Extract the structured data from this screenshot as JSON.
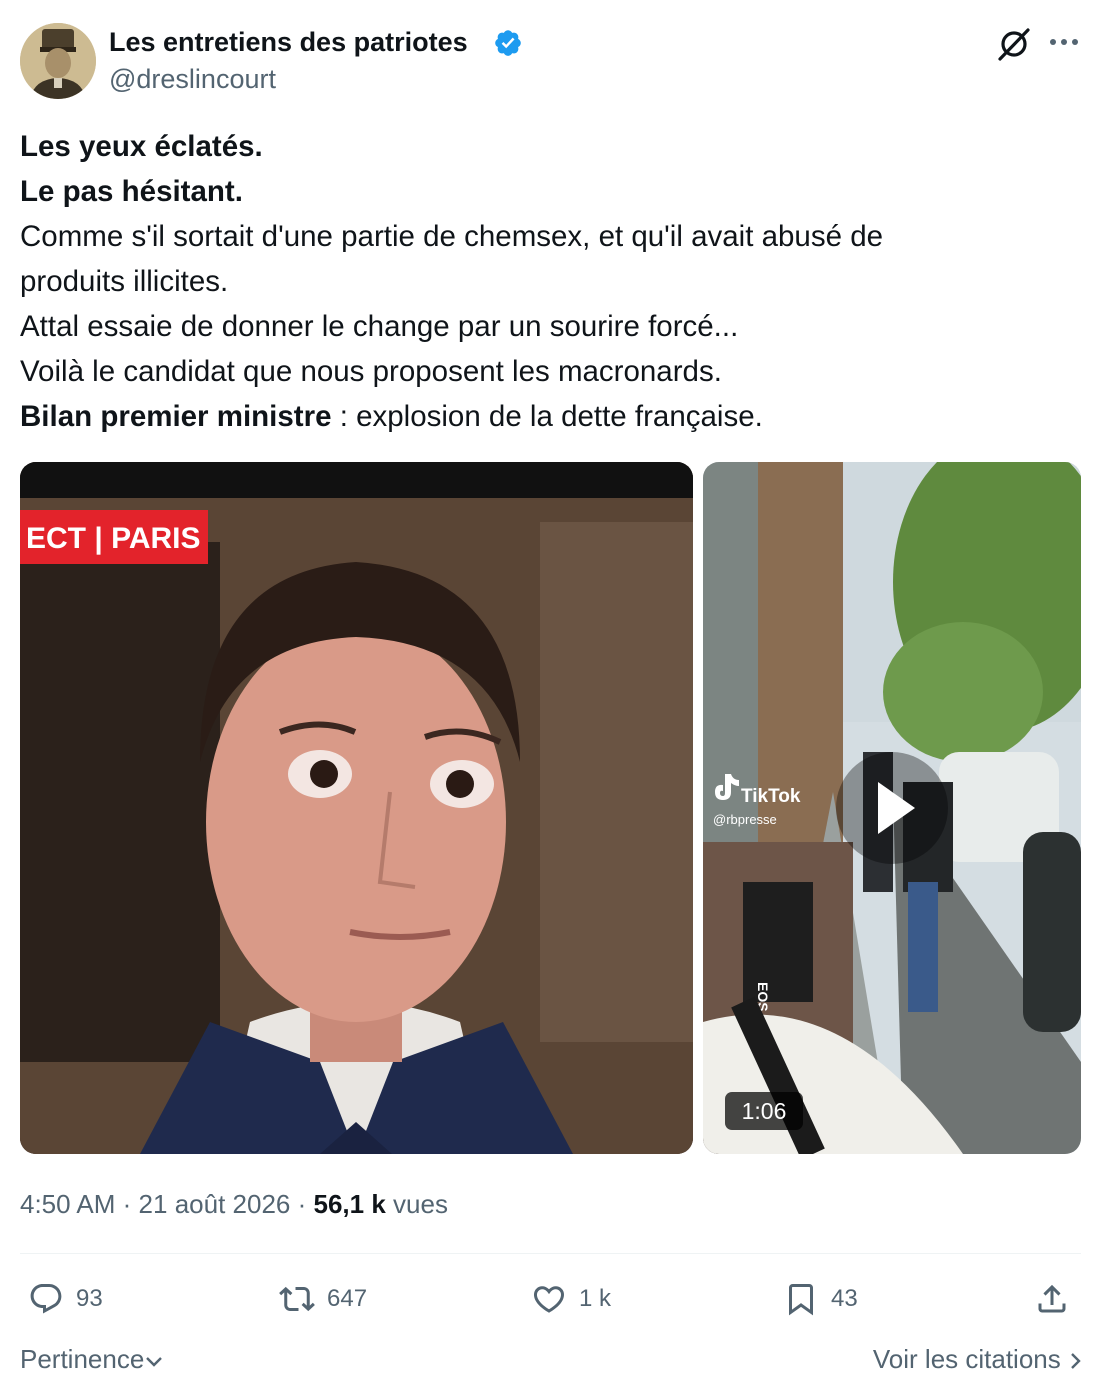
{
  "author": {
    "name": "Les entretiens des patriotes",
    "handle": "@dreslincourt"
  },
  "post": {
    "lines": [
      {
        "bold": "Les yeux éclatés.",
        "rest": ""
      },
      {
        "bold": "Le pas hésitant.",
        "rest": ""
      },
      {
        "bold": "",
        "rest": "Comme s'il sortait d'une partie de chemsex, et qu'il avait abusé de"
      },
      {
        "bold": "",
        "rest": "produits illicites."
      },
      {
        "bold": "",
        "rest": "Attal essaie de donner le change par un sourire forcé..."
      },
      {
        "bold": "",
        "rest": "Voilà le candidat que nous proposent les macronards."
      },
      {
        "bold": "Bilan premier ministre",
        "rest": " : explosion de la dette française."
      }
    ]
  },
  "media": {
    "image_overlay": "ECT | PARIS",
    "video_watermark": "TikTok",
    "video_watermark_handle": "@rbpresse",
    "video_duration": "1:06",
    "camera_label": "EOS R5"
  },
  "meta": {
    "time": "4:50 AM",
    "separator": "·",
    "date": "21 août 2026",
    "views_count": "56,1 k",
    "views_label": "vues"
  },
  "actions": {
    "replies": "93",
    "reposts": "647",
    "likes": "1 k",
    "bookmarks": "43"
  },
  "footer": {
    "sort_label": "Pertinence",
    "quotes_label": "Voir les citations"
  },
  "colors": {
    "text": "#0f1419",
    "secondary": "#536471",
    "verified": "#1d9bf0",
    "divider": "#eff3f4"
  }
}
